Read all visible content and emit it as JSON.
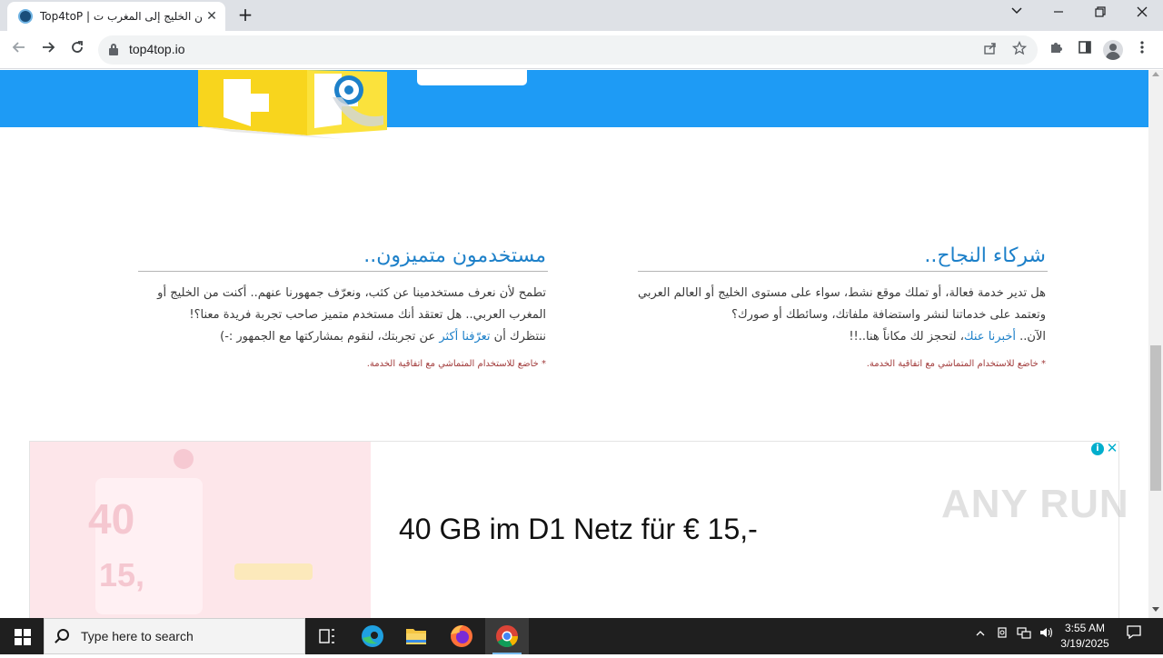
{
  "browser": {
    "tab_title": "Top4toP | من الخليج إلى المغرب ت",
    "tab_close": "✕",
    "new_tab": "+",
    "url": "top4top.io",
    "window_controls": {
      "dropdown": "⌄",
      "minimize": "—",
      "restore": "❐",
      "close": "✕"
    }
  },
  "page": {
    "right_column": {
      "heading": "شركاء النجاح..",
      "line1": "هل تدير خدمة فعالة، أو تملك موقع نشط، سواء على مستوى الخليج أو العالم العربي",
      "line2": "وتعتمد على خدماتنا لنشر واستضافة ملفاتك، وسائطك أو صورك؟",
      "line3_before": "الآن.. ",
      "line3_link": "أخبرنا عنك",
      "line3_after": "، لتحجز لك مكاناً هنا..!!",
      "note": "* خاضع للاستخدام المتماشي مع اتفاقية الخدمة."
    },
    "left_column": {
      "heading": "مستخدمون متميزون..",
      "line1": "تطمح لأن نعرف مستخدمينا عن كثب، ونعرّف جمهورنا عنهم.. أكنت من الخليج أو",
      "line2": "المغرب العربي.. هل تعتقد أنك مستخدم متميز صاحب تجربة فريدة معنا؟!",
      "line3_before": "ننتظرك أن ",
      "line3_link": "تعرّفنا أكثر",
      "line3_after": " عن تجربتك، لنقوم بمشاركتها مع الجمهور :-)",
      "note": "* خاضع للاستخدام المتماشي مع اتفاقية الخدمة."
    },
    "ad": {
      "headline": "40 GB im D1 Netz für € 15,-",
      "image_big": "40",
      "image_price": "15,",
      "info_icon": "i",
      "close_icon": "✕"
    },
    "watermark": "ANY RUN"
  },
  "taskbar": {
    "search_placeholder": "Type here to search",
    "time": "3:55 AM",
    "date": "3/19/2025"
  },
  "colors": {
    "hero": "#1e9bf5",
    "link": "#1d80c9",
    "note": "#a13a3a",
    "taskbar": "#1f1f1f"
  }
}
